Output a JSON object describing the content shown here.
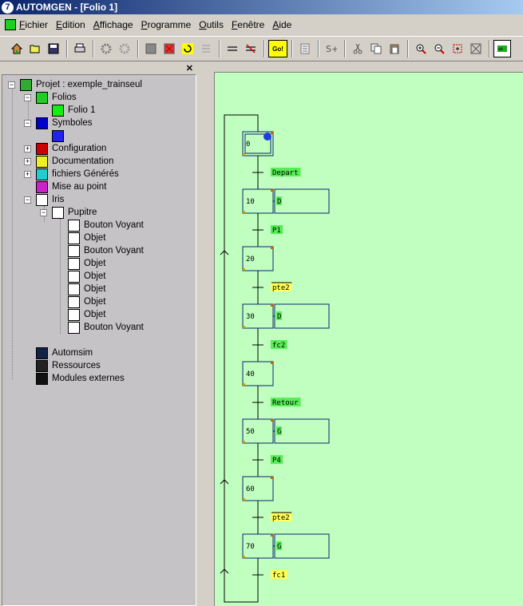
{
  "window": {
    "title": "AUTOMGEN - [Folio 1]",
    "logo_text": "7"
  },
  "menu": [
    "Fichier",
    "Edition",
    "Affichage",
    "Programme",
    "Outils",
    "Fenêtre",
    "Aide"
  ],
  "toolbar": {
    "go_label": "Go!"
  },
  "tree": {
    "project": "Projet : exemple_trainseul",
    "folios": "Folios",
    "folio1": "Folio 1",
    "symboles": "Symboles",
    "configuration": "Configuration",
    "documentation": "Documentation",
    "fichiers": "fichiers Générés",
    "mise_au_point": "Mise au point",
    "iris": "Iris",
    "pupitre": "Pupitre",
    "pupitre_items": [
      "Bouton Voyant",
      "Objet",
      "Bouton Voyant",
      "Objet",
      "Objet",
      "Objet",
      "Objet",
      "Objet",
      "Bouton Voyant"
    ],
    "automsim": "Automsim",
    "ressources": "Ressources",
    "modules": "Modules externes"
  },
  "grafcet": {
    "steps": [
      {
        "num": "0",
        "action": ""
      },
      {
        "num": "10",
        "action": "D"
      },
      {
        "num": "20",
        "action": ""
      },
      {
        "num": "30",
        "action": "D"
      },
      {
        "num": "40",
        "action": ""
      },
      {
        "num": "50",
        "action": "G"
      },
      {
        "num": "60",
        "action": ""
      },
      {
        "num": "70",
        "action": "G"
      }
    ],
    "transitions": [
      "Depart",
      "P1",
      "pte2",
      "fc2",
      "Retour",
      "P4",
      "pte2",
      "fc1"
    ]
  },
  "colors": {
    "canvas": "#c0ffc0",
    "label_bg": "#55ee55",
    "label_yellow": "#ffff55",
    "step_border": "#0a246a"
  }
}
